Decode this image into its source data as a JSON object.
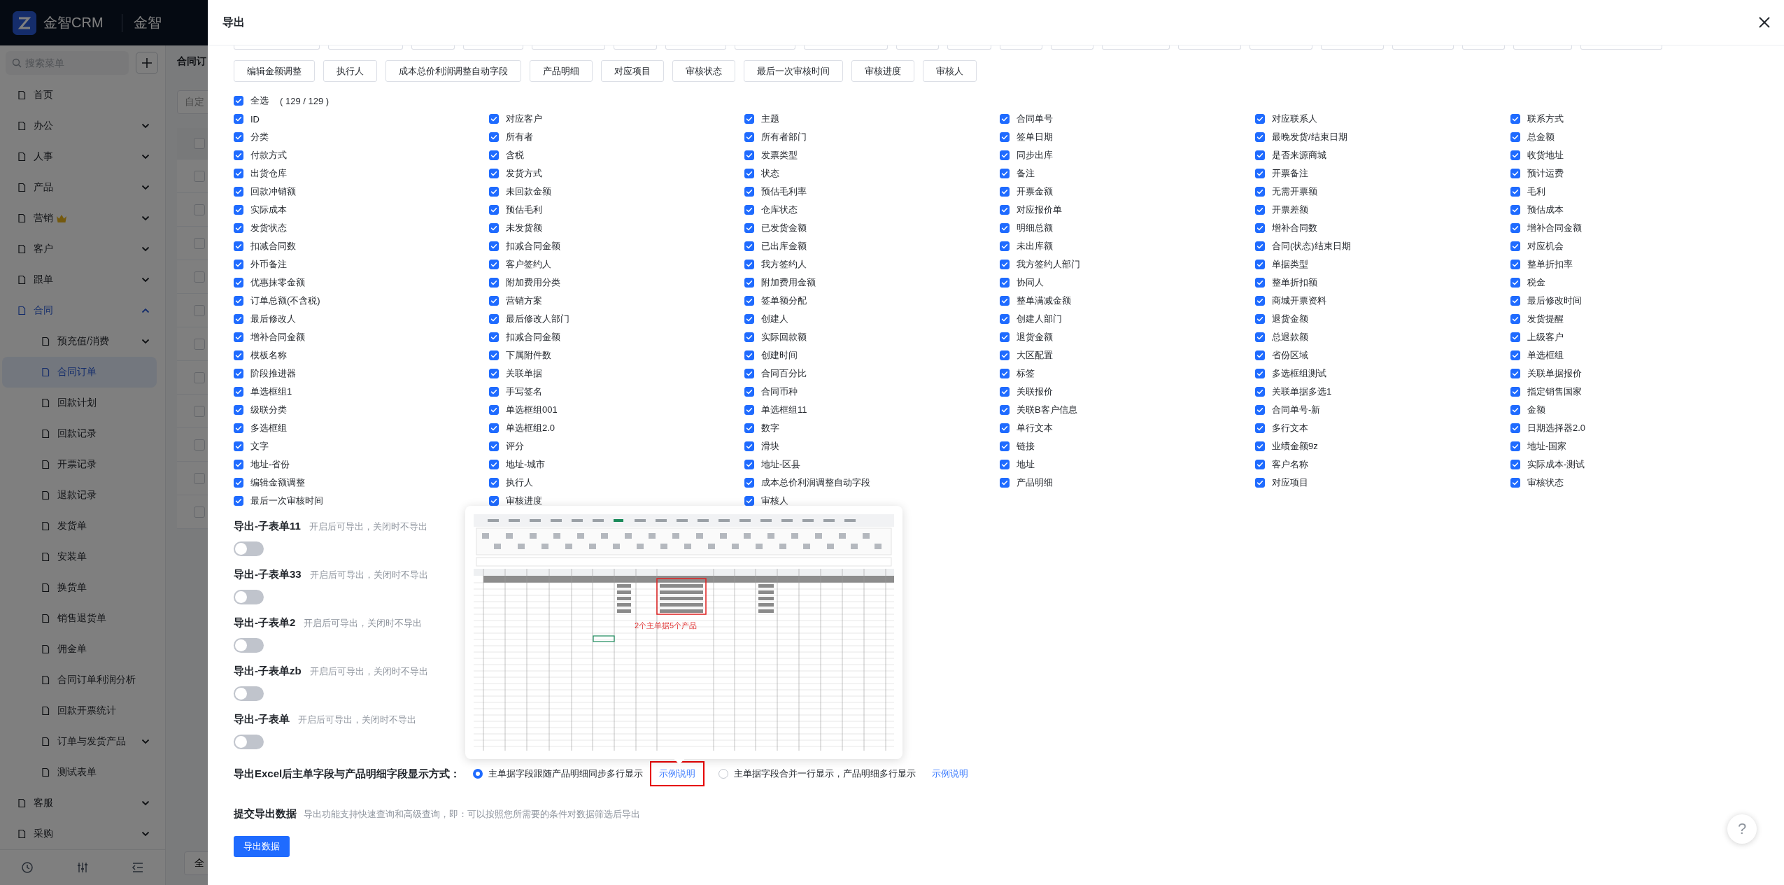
{
  "app_header": {
    "logo_text": "金智CRM",
    "workspace": "金智"
  },
  "sidebar": {
    "search_placeholder": "搜索菜单",
    "items": [
      {
        "label": "首页",
        "kind": "link",
        "selected": false,
        "premium": false
      },
      {
        "label": "办公",
        "kind": "group",
        "expanded": false,
        "selected": false,
        "premium": false
      },
      {
        "label": "人事",
        "kind": "group",
        "expanded": false,
        "selected": false,
        "premium": false
      },
      {
        "label": "产品",
        "kind": "group",
        "expanded": false,
        "selected": false,
        "premium": false
      },
      {
        "label": "营销",
        "kind": "group",
        "expanded": false,
        "selected": false,
        "premium": true
      },
      {
        "label": "客户",
        "kind": "group",
        "expanded": false,
        "selected": false,
        "premium": false
      },
      {
        "label": "跟单",
        "kind": "group",
        "expanded": false,
        "selected": false,
        "premium": false
      },
      {
        "label": "合同",
        "kind": "group",
        "expanded": true,
        "selected": false,
        "premium": false,
        "children": [
          {
            "label": "预充值/消费",
            "kind": "group",
            "expanded": false,
            "selected": false
          },
          {
            "label": "合同订单",
            "kind": "link",
            "selected": true
          },
          {
            "label": "回款计划",
            "kind": "link",
            "selected": false
          },
          {
            "label": "回款记录",
            "kind": "link",
            "selected": false
          },
          {
            "label": "开票记录",
            "kind": "link",
            "selected": false
          },
          {
            "label": "退款记录",
            "kind": "link",
            "selected": false
          },
          {
            "label": "发货单",
            "kind": "link",
            "selected": false
          },
          {
            "label": "安装单",
            "kind": "link",
            "selected": false
          },
          {
            "label": "换货单",
            "kind": "link",
            "selected": false
          },
          {
            "label": "销售退货单",
            "kind": "link",
            "selected": false
          },
          {
            "label": "佣金单",
            "kind": "link",
            "selected": false
          },
          {
            "label": "合同订单利润分析",
            "kind": "link",
            "selected": false
          },
          {
            "label": "回款开票统计",
            "kind": "link",
            "selected": false
          },
          {
            "label": "订单与发货产品",
            "kind": "group",
            "expanded": false,
            "selected": false
          },
          {
            "label": "测试表单",
            "kind": "link",
            "selected": false
          }
        ]
      },
      {
        "label": "客服",
        "kind": "group",
        "expanded": false,
        "selected": false,
        "premium": false
      },
      {
        "label": "采购",
        "kind": "group",
        "expanded": false,
        "selected": false,
        "premium": false
      }
    ]
  },
  "page_behind": {
    "title": "合同订",
    "filter_field": "自定",
    "header_checked": false,
    "table_rows": [
      {
        "checked": false
      },
      {
        "checked": false
      },
      {
        "checked": false
      },
      {
        "checked": false
      },
      {
        "checked": false
      },
      {
        "checked": false
      },
      {
        "checked": false
      },
      {
        "checked": false
      },
      {
        "checked": false
      },
      {
        "checked": false
      },
      {
        "checked": false
      }
    ],
    "footer_button": "全"
  },
  "dialog": {
    "title": "导出",
    "field_tags": [
      "编辑金额调整",
      "执行人",
      "成本总价利润调整自动字段",
      "产品明细",
      "对应项目",
      "审核状态",
      "最后一次审核时间",
      "审核进度",
      "审核人"
    ],
    "select_all": {
      "label": "全选",
      "count": "( 129 / 129 )",
      "checked": true
    },
    "field_columns": [
      [
        {
          "label": "ID",
          "checked": true
        },
        {
          "label": "分类",
          "checked": true
        },
        {
          "label": "付款方式",
          "checked": true
        },
        {
          "label": "出货仓库",
          "checked": true
        },
        {
          "label": "回款冲销额",
          "checked": true
        },
        {
          "label": "实际成本",
          "checked": true
        },
        {
          "label": "发货状态",
          "checked": true
        },
        {
          "label": "扣减合同数",
          "checked": true
        },
        {
          "label": "外币备注",
          "checked": true
        },
        {
          "label": "优惠抹零金额",
          "checked": true
        },
        {
          "label": "订单总额(不含税)",
          "checked": true
        },
        {
          "label": "最后修改人",
          "checked": true
        },
        {
          "label": "增补合同金额",
          "checked": true
        },
        {
          "label": "模板名称",
          "checked": true
        },
        {
          "label": "阶段推进器",
          "checked": true
        },
        {
          "label": "单选框组1",
          "checked": true
        },
        {
          "label": "级联分类",
          "checked": true
        },
        {
          "label": "多选框组",
          "checked": true
        },
        {
          "label": "文字",
          "checked": true
        },
        {
          "label": "地址-省份",
          "checked": true
        },
        {
          "label": "编辑金额调整",
          "checked": true
        },
        {
          "label": "最后一次审核时间",
          "checked": true
        }
      ],
      [
        {
          "label": "对应客户",
          "checked": true
        },
        {
          "label": "所有者",
          "checked": true
        },
        {
          "label": "含税",
          "checked": true
        },
        {
          "label": "发货方式",
          "checked": true
        },
        {
          "label": "未回款金额",
          "checked": true
        },
        {
          "label": "预估毛利",
          "checked": true
        },
        {
          "label": "未发货额",
          "checked": true
        },
        {
          "label": "扣减合同金额",
          "checked": true
        },
        {
          "label": "客户签约人",
          "checked": true
        },
        {
          "label": "附加费用分类",
          "checked": true
        },
        {
          "label": "营销方案",
          "checked": true
        },
        {
          "label": "最后修改人部门",
          "checked": true
        },
        {
          "label": "扣减合同金额",
          "checked": true
        },
        {
          "label": "下属附件数",
          "checked": true
        },
        {
          "label": "关联单据",
          "checked": true
        },
        {
          "label": "手写签名",
          "checked": true
        },
        {
          "label": "单选框组001",
          "checked": true
        },
        {
          "label": "单选框组2.0",
          "checked": true
        },
        {
          "label": "评分",
          "checked": true
        },
        {
          "label": "地址-城市",
          "checked": true
        },
        {
          "label": "执行人",
          "checked": true
        },
        {
          "label": "审核进度",
          "checked": true
        }
      ],
      [
        {
          "label": "主题",
          "checked": true
        },
        {
          "label": "所有者部门",
          "checked": true
        },
        {
          "label": "发票类型",
          "checked": true
        },
        {
          "label": "状态",
          "checked": true
        },
        {
          "label": "预估毛利率",
          "checked": true
        },
        {
          "label": "仓库状态",
          "checked": true
        },
        {
          "label": "已发货金额",
          "checked": true
        },
        {
          "label": "已出库金额",
          "checked": true
        },
        {
          "label": "我方签约人",
          "checked": true
        },
        {
          "label": "附加费用金额",
          "checked": true
        },
        {
          "label": "签单额分配",
          "checked": true
        },
        {
          "label": "创建人",
          "checked": true
        },
        {
          "label": "实际回款额",
          "checked": true
        },
        {
          "label": "创建时间",
          "checked": true
        },
        {
          "label": "合同百分比",
          "checked": true
        },
        {
          "label": "合同币种",
          "checked": true
        },
        {
          "label": "单选框组11",
          "checked": true
        },
        {
          "label": "数字",
          "checked": true
        },
        {
          "label": "滑块",
          "checked": true
        },
        {
          "label": "地址-区县",
          "checked": true
        },
        {
          "label": "成本总价利润调整自动字段",
          "checked": true
        },
        {
          "label": "审核人",
          "checked": true
        }
      ],
      [
        {
          "label": "合同单号",
          "checked": true
        },
        {
          "label": "签单日期",
          "checked": true
        },
        {
          "label": "同步出库",
          "checked": true
        },
        {
          "label": "备注",
          "checked": true
        },
        {
          "label": "开票金额",
          "checked": true
        },
        {
          "label": "对应报价单",
          "checked": true
        },
        {
          "label": "明细总额",
          "checked": true
        },
        {
          "label": "未出库额",
          "checked": true
        },
        {
          "label": "我方签约人部门",
          "checked": true
        },
        {
          "label": "协同人",
          "checked": true
        },
        {
          "label": "整单满减金额",
          "checked": true
        },
        {
          "label": "创建人部门",
          "checked": true
        },
        {
          "label": "退货金额",
          "checked": true
        },
        {
          "label": "大区配置",
          "checked": true
        },
        {
          "label": "标签",
          "checked": true
        },
        {
          "label": "关联报价",
          "checked": true
        },
        {
          "label": "关联B客户信息",
          "checked": true
        },
        {
          "label": "单行文本",
          "checked": true
        },
        {
          "label": "链接",
          "checked": true
        },
        {
          "label": "地址",
          "checked": true
        },
        {
          "label": "产品明细",
          "checked": true
        }
      ],
      [
        {
          "label": "对应联系人",
          "checked": true
        },
        {
          "label": "最晚发货/结束日期",
          "checked": true
        },
        {
          "label": "是否来源商城",
          "checked": true
        },
        {
          "label": "开票备注",
          "checked": true
        },
        {
          "label": "无需开票额",
          "checked": true
        },
        {
          "label": "开票差额",
          "checked": true
        },
        {
          "label": "增补合同数",
          "checked": true
        },
        {
          "label": "合同(状态)结束日期",
          "checked": true
        },
        {
          "label": "单据类型",
          "checked": true
        },
        {
          "label": "整单折扣额",
          "checked": true
        },
        {
          "label": "商城开票资料",
          "checked": true
        },
        {
          "label": "退货金额",
          "checked": true
        },
        {
          "label": "总退款额",
          "checked": true
        },
        {
          "label": "省份区域",
          "checked": true
        },
        {
          "label": "多选框组测试",
          "checked": true
        },
        {
          "label": "关联单据多选1",
          "checked": true
        },
        {
          "label": "合同单号-新",
          "checked": true
        },
        {
          "label": "多行文本",
          "checked": true
        },
        {
          "label": "业绩金额9z",
          "checked": true
        },
        {
          "label": "客户名称",
          "checked": true
        },
        {
          "label": "对应项目",
          "checked": true
        }
      ],
      [
        {
          "label": "联系方式",
          "checked": true
        },
        {
          "label": "总金额",
          "checked": true
        },
        {
          "label": "收货地址",
          "checked": true
        },
        {
          "label": "预计运费",
          "checked": true
        },
        {
          "label": "毛利",
          "checked": true
        },
        {
          "label": "预估成本",
          "checked": true
        },
        {
          "label": "增补合同金额",
          "checked": true
        },
        {
          "label": "对应机会",
          "checked": true
        },
        {
          "label": "整单折扣率",
          "checked": true
        },
        {
          "label": "税金",
          "checked": true
        },
        {
          "label": "最后修改时间",
          "checked": true
        },
        {
          "label": "发货提醒",
          "checked": true
        },
        {
          "label": "上级客户",
          "checked": true
        },
        {
          "label": "单选框组",
          "checked": true
        },
        {
          "label": "关联单据报价",
          "checked": true
        },
        {
          "label": "指定销售国家",
          "checked": true
        },
        {
          "label": "金额",
          "checked": true
        },
        {
          "label": "日期选择器2.0",
          "checked": true
        },
        {
          "label": "地址-国家",
          "checked": true
        },
        {
          "label": "实际成本-测试",
          "checked": true
        },
        {
          "label": "审核状态",
          "checked": true
        }
      ]
    ],
    "subforms": [
      {
        "title": "导出-子表单11",
        "hint": "开启后可导出，关闭时不导出",
        "on": false
      },
      {
        "title": "导出-子表单33",
        "hint": "开启后可导出，关闭时不导出",
        "on": false
      },
      {
        "title": "导出-子表单2",
        "hint": "开启后可导出，关闭时不导出",
        "on": false
      },
      {
        "title": "导出-子表单zb",
        "hint": "开启后可导出，关闭时不导出",
        "on": false
      },
      {
        "title": "导出-子表单",
        "hint": "开启后可导出，关闭时不导出",
        "on": false
      }
    ],
    "display_mode": {
      "label": "导出Excel后主单字段与产品明细字段显示方式：",
      "options": [
        {
          "label": "主单据字段跟随产品明细同步多行显示",
          "selected": true,
          "link": "示例说明",
          "highlighted": true
        },
        {
          "label": "主单据字段合并一行显示，产品明细多行显示",
          "selected": false,
          "link": "示例说明",
          "highlighted": false
        }
      ]
    },
    "example_popup": {
      "caption": "2个主单据5个产品"
    },
    "submit": {
      "title": "提交导出数据",
      "hint": "导出功能支持快速查询和高级查询，即：可以按照您所需要的条件对数据筛选后导出",
      "button": "导出数据"
    },
    "help_button": "?"
  }
}
